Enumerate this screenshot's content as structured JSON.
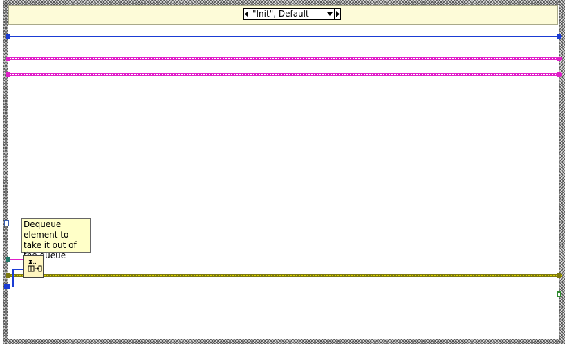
{
  "case_selector": {
    "value": "\"Init\", Default",
    "left_arrow_icon": "triangle-left",
    "right_arrow_icon": "triangle-right",
    "dropdown_icon": "triangle-down"
  },
  "comment": {
    "text": "Dequeue element to take it out of the queue"
  },
  "dequeue_node": {
    "icon": "dequeue-element-icon"
  },
  "colors": {
    "blue_wire": "#1b3cd4",
    "pink_wire": "#e020c8",
    "olive_wire": "#7d7a10",
    "teal_wire": "#1f7a6a",
    "header_bg": "#fdfbd8"
  }
}
